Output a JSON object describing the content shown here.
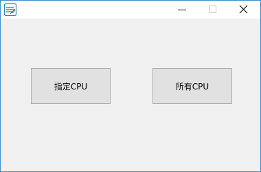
{
  "window": {
    "app_icon": "app-logo-icon",
    "controls": {
      "minimize_icon": "minimize-icon",
      "maximize_icon": "maximize-icon",
      "close_icon": "close-icon"
    }
  },
  "main": {
    "buttons": [
      {
        "label": "指定CPU"
      },
      {
        "label": "所有CPU"
      }
    ]
  },
  "colors": {
    "border_accent": "#3c8dc6",
    "client_background": "#f0f0f0",
    "button_face": "#e1e1e1",
    "button_border": "#adadad",
    "titlebar_background": "#ffffff"
  }
}
